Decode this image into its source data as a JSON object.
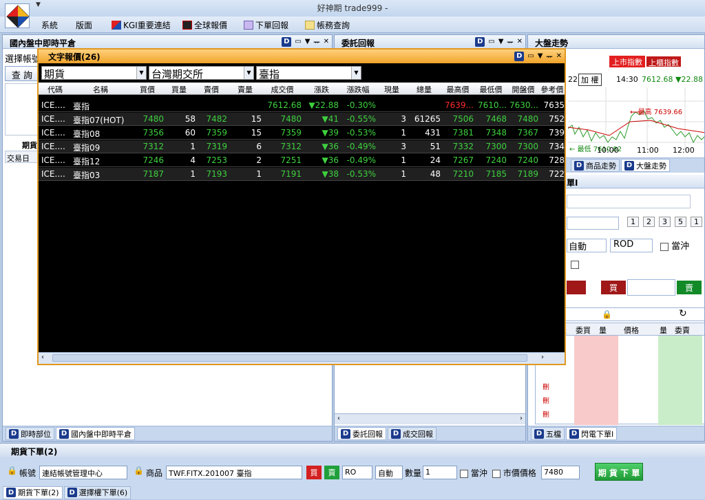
{
  "app": {
    "title": "好神期 trade999 -"
  },
  "menu": [
    "系統",
    "版面",
    "KGI重要連結",
    "全球報價",
    "下單回報",
    "帳務查詢"
  ],
  "panes": {
    "left": {
      "title": "國內盤中即時平倉",
      "account_label": "選擇帳號",
      "query_btn": "查 詢",
      "tab_futures": "期貨",
      "trade_day": "交易日",
      "tabs": [
        "即時部位",
        "國內盤中即時平倉"
      ]
    },
    "middle": {
      "title": "委託回報",
      "tabs": [
        "委託回報",
        "成交回報"
      ]
    },
    "right": {
      "title": "大盤走勢",
      "listed": "上市指數",
      "otc": "上櫃指數",
      "weighted": "加 權",
      "time": "14:30",
      "index": "7612.68",
      "change": "▼22.88",
      "num": "22",
      "high_label": "最高 7639.66",
      "low_label": "最低 7610.82",
      "x1": "10:00",
      "x2": "11:00",
      "x3": "12:00",
      "tabs": [
        "商品走勢",
        "大盤走勢"
      ],
      "tab_label_fragment": "單I",
      "auto": "自動",
      "rod": "ROD",
      "daytrade": "當沖",
      "buy": "買",
      "sell": "賣",
      "qty_btns": [
        "1",
        "2",
        "3",
        "5",
        "1"
      ],
      "book_cols": [
        "報",
        "委買",
        "量",
        "價格",
        "量",
        "委賣"
      ],
      "del": "刪",
      "ladder_tabs": [
        "五檔",
        "閃電下單I"
      ]
    }
  },
  "quote": {
    "title": "文字報價(26)",
    "selects": [
      "期貨",
      "台灣期交所",
      "臺指"
    ],
    "columns": [
      "代碼",
      "名稱",
      "買價",
      "買量",
      "賣價",
      "賣量",
      "成交價",
      "漲跌",
      "漲跌幅",
      "現量",
      "總量",
      "最高價",
      "最低價",
      "開盤價",
      "參考價"
    ],
    "rows": [
      {
        "code": "ICE....",
        "name": "臺指",
        "bid": "",
        "bidv": "",
        "ask": "",
        "askv": "",
        "last": "7612.68",
        "chg": "▼22.88",
        "pct": "-0.30%",
        "vol": "",
        "tot": "",
        "high": "7639...",
        "low": "7610...",
        "open": "7630...",
        "ref": "7635"
      },
      {
        "code": "ICE....",
        "name": "臺指07(HOT)",
        "bid": "7480",
        "bidv": "58",
        "ask": "7482",
        "askv": "15",
        "last": "7480",
        "chg": "▼41",
        "pct": "-0.55%",
        "vol": "3",
        "tot": "61265",
        "high": "7506",
        "low": "7468",
        "open": "7480",
        "ref": "752"
      },
      {
        "code": "ICE....",
        "name": "臺指08",
        "bid": "7356",
        "bidv": "60",
        "ask": "7359",
        "askv": "15",
        "last": "7359",
        "chg": "▼39",
        "pct": "-0.53%",
        "vol": "1",
        "tot": "431",
        "high": "7381",
        "low": "7348",
        "open": "7367",
        "ref": "739"
      },
      {
        "code": "ICE....",
        "name": "臺指09",
        "bid": "7312",
        "bidv": "1",
        "ask": "7319",
        "askv": "6",
        "last": "7312",
        "chg": "▼36",
        "pct": "-0.49%",
        "vol": "3",
        "tot": "51",
        "high": "7332",
        "low": "7300",
        "open": "7300",
        "ref": "734"
      },
      {
        "code": "ICE....",
        "name": "臺指12",
        "bid": "7246",
        "bidv": "4",
        "ask": "7253",
        "askv": "2",
        "last": "7251",
        "chg": "▼36",
        "pct": "-0.49%",
        "vol": "1",
        "tot": "24",
        "high": "7267",
        "low": "7240",
        "open": "7240",
        "ref": "728"
      },
      {
        "code": "ICE....",
        "name": "臺指03",
        "bid": "7187",
        "bidv": "1",
        "ask": "7193",
        "askv": "1",
        "last": "7191",
        "chg": "▼38",
        "pct": "-0.53%",
        "vol": "1",
        "tot": "48",
        "high": "7210",
        "low": "7185",
        "open": "7189",
        "ref": "722"
      }
    ]
  },
  "order": {
    "title": "期貨下單(2)",
    "account_label": "帳號",
    "account": "連結帳號管理中心",
    "product_label": "商品",
    "product": "TWF.FITX.201007 臺指",
    "buy": "買",
    "sell": "賣",
    "type": "RO",
    "auto": "自動",
    "qty_label": "數量",
    "qty": "1",
    "daytrade": "當沖",
    "market": "市價價格",
    "price": "7480",
    "submit": "期 貨 下 單"
  },
  "bottom_tabs": [
    "期貨下單(2)",
    "選擇權下單(6)"
  ]
}
